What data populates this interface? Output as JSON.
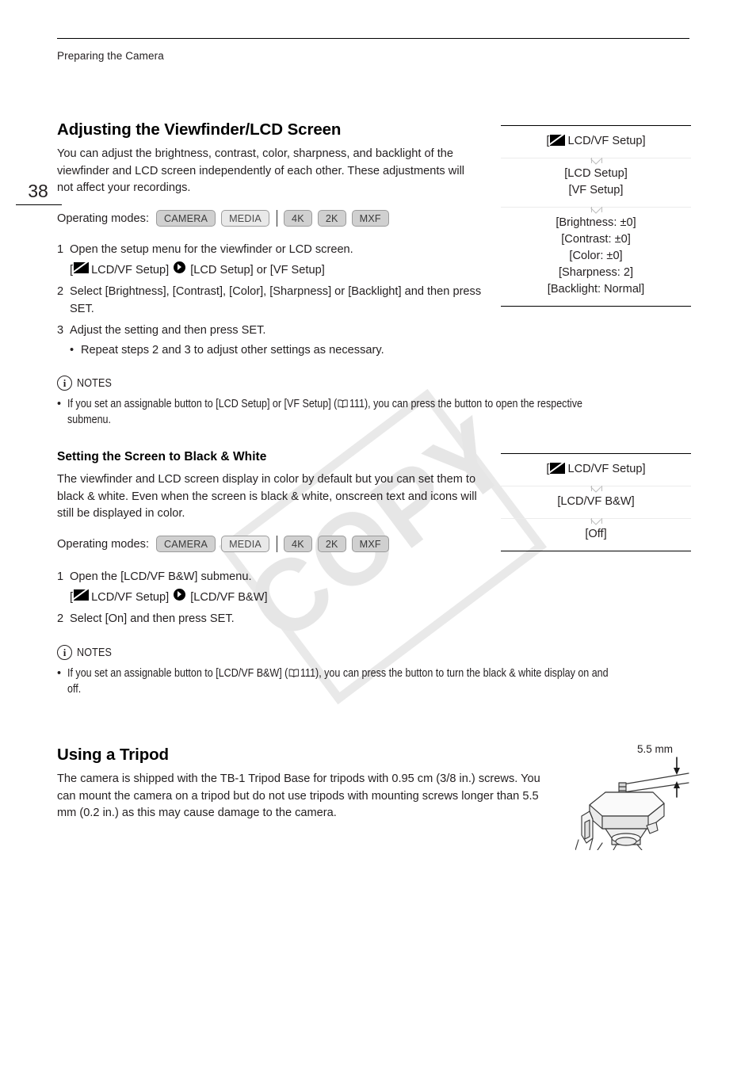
{
  "page": {
    "running_head": "Preparing the Camera",
    "folio": "38"
  },
  "section1": {
    "title": "Adjusting the Viewfinder/LCD Screen",
    "intro": "You can adjust the brightness, contrast, color, sharpness, and backlight of the viewfinder and LCD screen independently of each other. These adjustments will not affect your recordings.",
    "opmodes_label": "Operating modes:",
    "badges": [
      {
        "label": "CAMERA",
        "active": true
      },
      {
        "label": "MEDIA",
        "active": false
      },
      {
        "label": "4K",
        "active": true
      },
      {
        "label": "2K",
        "active": true
      },
      {
        "label": "MXF",
        "active": true
      }
    ],
    "steps": [
      {
        "num": "1",
        "text": "Open the setup menu for the viewfinder or LCD screen."
      },
      {
        "num": "2",
        "text": "Select [Brightness], [Contrast], [Color], [Sharpness] or [Backlight] and then press SET."
      },
      {
        "num": "3",
        "text": "Adjust the setting and then press SET."
      }
    ],
    "path": {
      "open_bracket": "[",
      "menu_name": "LCD/VF Setup]",
      "target": "[LCD Setup] or [VF Setup]"
    },
    "substep": "Repeat steps 2 and 3 to adjust other settings as necessary.",
    "notes_label": "NOTES",
    "notes": [
      {
        "before": "If you set an assignable button to [LCD Setup] or [VF Setup] (",
        "page_ref": "111",
        "after": "), you can press the button to open the respective submenu."
      }
    ]
  },
  "menu1": {
    "rows": [
      {
        "lines": [
          "LCD/VF Setup]"
        ],
        "has_icon": true,
        "prefix": "["
      },
      {
        "lines": [
          "[LCD Setup]",
          "[VF Setup]"
        ],
        "has_icon": false
      },
      {
        "lines": [
          "[Brightness: ±0]",
          "[Contrast: ±0]",
          "[Color: ±0]",
          "[Sharpness: 2]",
          "[Backlight: Normal]"
        ],
        "has_icon": false
      }
    ]
  },
  "section2": {
    "title": "Setting the Screen to Black & White",
    "intro": "The viewfinder and LCD screen display in color by default but you can set them to black & white. Even when the screen is black & white, onscreen text and icons will still be displayed in color.",
    "opmodes_label": "Operating modes:",
    "badges": [
      {
        "label": "CAMERA",
        "active": true
      },
      {
        "label": "MEDIA",
        "active": false
      },
      {
        "label": "4K",
        "active": true
      },
      {
        "label": "2K",
        "active": true
      },
      {
        "label": "MXF",
        "active": true
      }
    ],
    "steps": [
      {
        "num": "1",
        "text": "Open the [LCD/VF B&W] submenu."
      },
      {
        "num": "2",
        "text": "Select [On] and then press SET."
      }
    ],
    "path": {
      "open_bracket": "[",
      "menu_name": "LCD/VF Setup]",
      "target": "[LCD/VF B&W]"
    },
    "notes_label": "NOTES",
    "notes": [
      {
        "before": "If you set an assignable button to [LCD/VF B&W] (",
        "page_ref": "111",
        "after": "), you can press the button to turn the black & white display on and off."
      }
    ]
  },
  "menu2": {
    "rows": [
      {
        "lines": [
          "LCD/VF Setup]"
        ],
        "has_icon": true,
        "prefix": "["
      },
      {
        "lines": [
          "[LCD/VF B&W]"
        ],
        "has_icon": false
      },
      {
        "lines": [
          "[Off]"
        ],
        "has_icon": false
      }
    ]
  },
  "section3": {
    "title": "Using a Tripod",
    "intro": "The camera is shipped with the TB-1 Tripod Base for tripods with 0.95 cm (3/8 in.) screws. You can mount the camera on a tripod but do not use tripods with mounting screws longer than 5.5 mm (0.2 in.) as this may cause damage to the camera.",
    "figure_dimension": "5.5 mm"
  },
  "watermark": {
    "text": "COPY"
  },
  "colors": {
    "text": "#231f20",
    "rule": "#000000",
    "badge_fill": "#e9e9e9",
    "badge_fill_active": "#d0d0d0",
    "badge_border": "#9b9b9b",
    "watermark": "#e6e6e6",
    "menu_divider": "#ececec"
  }
}
